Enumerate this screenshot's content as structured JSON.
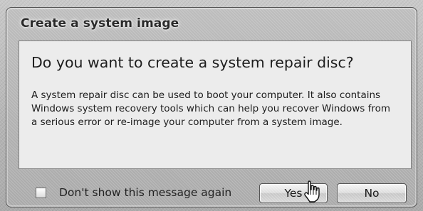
{
  "window": {
    "title": "Create a system image"
  },
  "dialog": {
    "heading": "Do you want to create a system repair disc?",
    "body": "A system repair disc can be used to boot your computer. It also contains Windows system recovery tools which can help you recover Windows from a serious error or re-image your computer from a system image."
  },
  "footer": {
    "checkbox_label": "Don't show this message again",
    "checkbox_checked": false,
    "yes_label": "Yes",
    "no_label": "No"
  },
  "icons": {
    "pointer": "hand-cursor-icon"
  }
}
